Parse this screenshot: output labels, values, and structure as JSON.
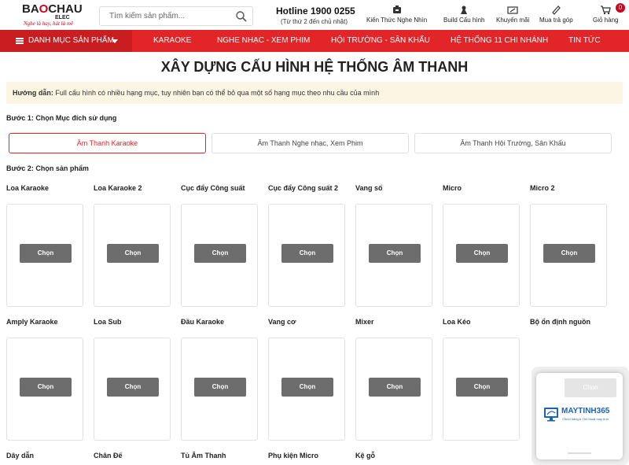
{
  "header": {
    "logo": {
      "brand_left": "BA",
      "brand_o": "O",
      "brand_right": "CHAU",
      "sub": "ELEC",
      "slogan": "Nghe là hay, hát là mê"
    },
    "search": {
      "placeholder": "Tìm kiếm sản phẩm..."
    },
    "hotline": "Hotline 1900 0255",
    "hotline_hours": "(Từ thứ 2 đến chủ nhật)",
    "links": [
      {
        "label": "Kiến Thức Nghe Nhìn",
        "icon": "knowledge-icon"
      },
      {
        "label": "Build Cấu hình",
        "icon": "build-icon"
      },
      {
        "label": "Khuyến mãi",
        "icon": "promotion-icon"
      },
      {
        "label": "Mua trả góp",
        "icon": "installment-icon"
      },
      {
        "label": "Giỏ hàng",
        "icon": "cart-icon"
      }
    ],
    "cart_count": "0"
  },
  "nav": {
    "category_label": "DANH MỤC SẢN PHẨM",
    "items": [
      "KARAOKE",
      "NGHE NHẠC - XEM PHIM",
      "HỘI TRƯỜNG - SÂN KHẤU",
      "HỆ THỐNG 11 CHI NHÁNH",
      "TIN TỨC"
    ]
  },
  "main": {
    "title": "XÂY DỰNG CẤU HÌNH HỆ THỐNG ÂM THANH",
    "guide_label": "Hướng dẫn:",
    "guide_text": " Full cấu hình có nhiều hạng mục, tuy nhiên bạn có thể bỏ qua một số hạng mục theo nhu cầu của mình",
    "step1": "Bước 1: Chọn Mục đích sử dụng",
    "purposes": [
      "Âm Thanh Karaoke",
      "Âm Thanh Nghe nhạc, Xem Phim",
      "Âm Thanh Hội Trường, Sân Khấu"
    ],
    "step2": "Bước 2: Chọn sản phẩm",
    "choose_label": "Chọn",
    "categories_row1": [
      "Loa Karaoke",
      "Loa Karaoke 2",
      "Cục đẩy Công suất",
      "Cục đẩy Công suất 2",
      "Vang số",
      "Micro",
      "Micro 2"
    ],
    "categories_row2": [
      "Amply Karaoke",
      "Loa Sub",
      "Đầu Karaoke",
      "Vang cơ",
      "Mixer",
      "Loa Kéo",
      "Bộ ổn định nguồn"
    ],
    "categories_row3": [
      "Dây dẫn",
      "Chân Đế",
      "Tủ Âm Thanh",
      "Phụ kiện Micro",
      "Kệ gỗ"
    ]
  },
  "ad": {
    "name": "MAYTINH365",
    "tagline": "Chính hãng & Thủ thuật máy tính",
    "button": "Chọn"
  },
  "colors": {
    "accent": "#e12528",
    "button": "#6d6d6d",
    "guide_bg": "#fdf5e3"
  }
}
